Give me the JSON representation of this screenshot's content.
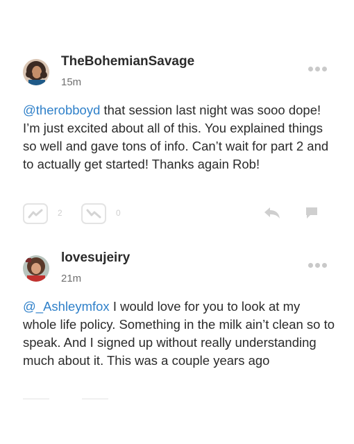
{
  "comments": [
    {
      "username": "TheBohemianSavage",
      "time": "15m",
      "mention": "@therobboyd",
      "text": " that session last night was sooo dope! I’m just excited about all of this. You explained things so well and gave tons of info. Can’t wait for part 2 and to actually get started! Thanks again Rob!",
      "like_count": "2",
      "other_count": "0",
      "avatar_icon": "avatar-woman-curly-hair",
      "more_icon": "ellipsis-icon"
    },
    {
      "username": "lovesujeiry",
      "time": "21m",
      "mention": "@_Ashleymfox",
      "text": " I would love for you to look at my whole life policy. Something in the milk ain’t clean so to speak. And I signed up without really understanding much about it. This was a couple years ago",
      "avatar_icon": "avatar-woman-red-top",
      "more_icon": "ellipsis-icon"
    }
  ],
  "colors": {
    "mention": "#2f80c9",
    "icon_gray": "#cccccc",
    "text": "#2a2a2a"
  }
}
